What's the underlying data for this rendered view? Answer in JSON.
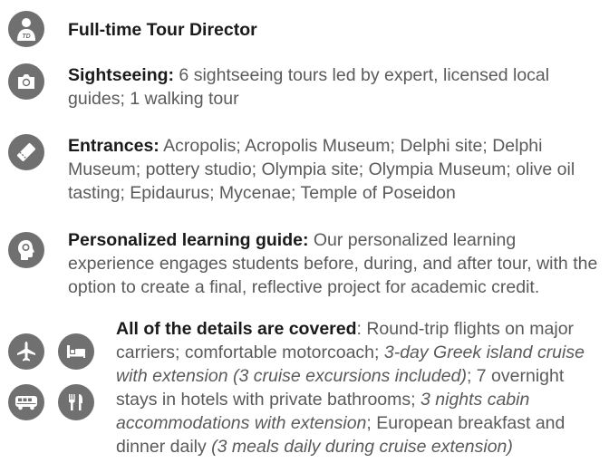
{
  "items": [
    {
      "icon": "tour-director-icon",
      "label": "Full-time Tour Director",
      "text": ""
    },
    {
      "icon": "camera-icon",
      "label": "Sightseeing:",
      "text": " 6 sightseeing tours led by expert, licensed local guides; 1 walking tour"
    },
    {
      "icon": "ticket-icon",
      "label": "Entrances:",
      "text": " Acropolis; Acropolis Museum; Delphi site; Delphi Museum; pottery studio; Olympia site; Olympia Museum; olive oil tasting; Epidaurus; Mycenae; Temple of Poseidon"
    },
    {
      "icon": "head-learning-icon",
      "label": "Personalized learning guide:",
      "text": " Our personalized learning experience engages students before, during, and after tour, with the option to create a final, reflective project for academic credit."
    }
  ],
  "details": {
    "icons": [
      "airplane-icon",
      "bed-icon",
      "bus-icon",
      "dining-icon"
    ],
    "label": "All of the details are covered",
    "segments": [
      {
        "t": ": Round-trip flights on major carriers; comfortable motorcoach; ",
        "i": false
      },
      {
        "t": "3-day Greek island cruise with extension (3 cruise excursions included)",
        "i": true
      },
      {
        "t": "; 7 overnight stays in hotels with private bathrooms; ",
        "i": false
      },
      {
        "t": "3 nights cabin accommodations with extension",
        "i": true
      },
      {
        "t": "; European breakfast and dinner daily ",
        "i": false
      },
      {
        "t": "(3 meals daily during cruise extension)",
        "i": true
      }
    ]
  },
  "colors": {
    "icon_bg": "#707070",
    "label": "#1a1a1a",
    "body_text": "#5a5a5a"
  }
}
